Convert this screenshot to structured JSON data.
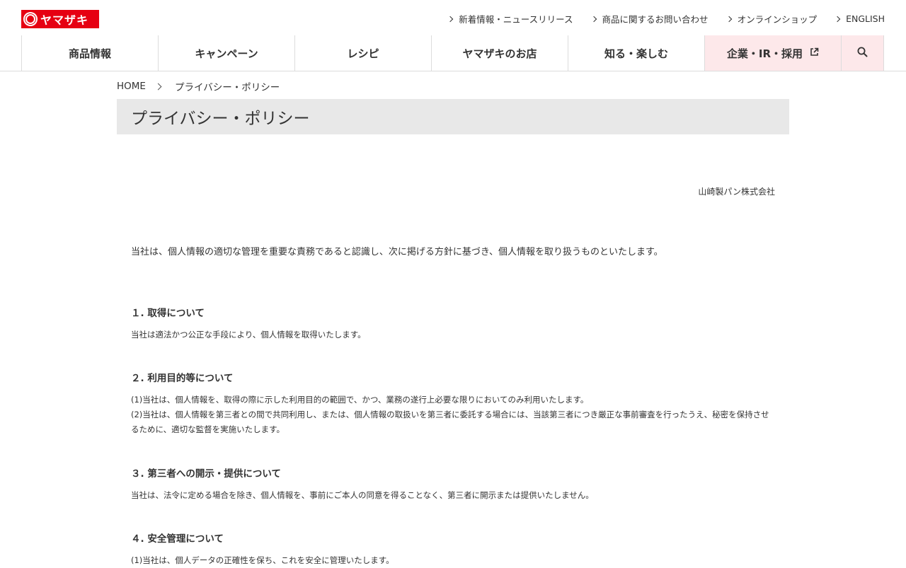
{
  "header": {
    "logo_text": "ヤマザキ",
    "utility_links": [
      {
        "label": "新着情報・ニュースリリース"
      },
      {
        "label": "商品に関するお問い合わせ"
      },
      {
        "label": "オンラインショップ"
      },
      {
        "label": "ENGLISH"
      }
    ]
  },
  "gnav": {
    "items": [
      "商品情報",
      "キャンペーン",
      "レシピ",
      "ヤマザキのお店",
      "知る・楽しむ"
    ],
    "corporate_label": "企業・IR・採用",
    "corporate_icon": "external-link-icon",
    "search_icon": "search-icon",
    "highlight_color": "#fde8ea",
    "brand_color": "#e60012"
  },
  "breadcrumb": {
    "home": "HOME",
    "current": "プライバシー・ポリシー"
  },
  "page": {
    "title": "プライバシー・ポリシー",
    "company": "山崎製パン株式会社",
    "intro": "当社は、個人情報の適切な管理を重要な責務であると認識し、次に掲げる方針に基づき、個人情報を取り扱うものといたします。"
  },
  "sections": [
    {
      "heading": "１. 取得について",
      "paragraphs": [
        "当社は適法かつ公正な手段により、個人情報を取得いたします。"
      ]
    },
    {
      "heading": "２. 利用目的等について",
      "paragraphs": [
        "(1)当社は、個人情報を、取得の際に示した利用目的の範囲で、かつ、業務の遂行上必要な限りにおいてのみ利用いたします。",
        "(2)当社は、個人情報を第三者との間で共同利用し、または、個人情報の取扱いを第三者に委託する場合には、当該第三者につき厳正な事前審査を行ったうえ、秘密を保持させるために、適切な監督を実施いたします。"
      ]
    },
    {
      "heading": "３. 第三者への開示・提供について",
      "paragraphs": [
        "当社は、法令に定める場合を除き、個人情報を、事前にご本人の同意を得ることなく、第三者に開示または提供いたしません。"
      ]
    },
    {
      "heading": "４. 安全管理について",
      "paragraphs": [
        "(1)当社は、個人データの正確性を保ち、これを安全に管理いたします。"
      ]
    }
  ]
}
